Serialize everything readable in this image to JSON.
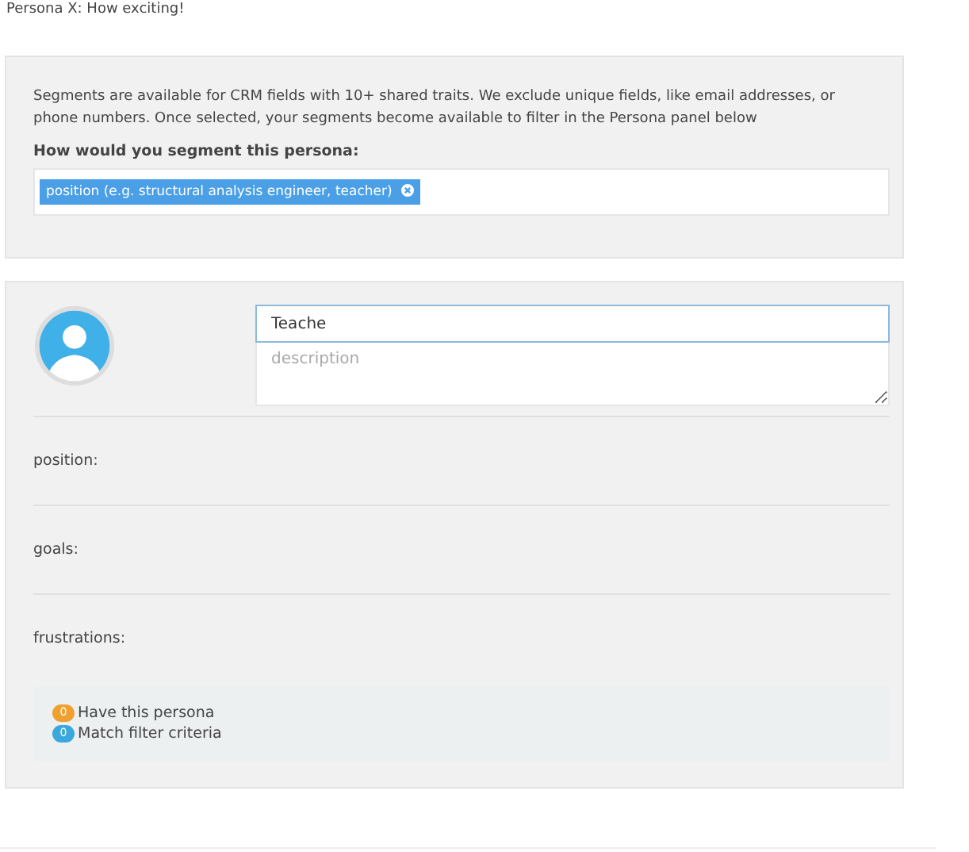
{
  "heading": "Persona X: How exciting!",
  "segments": {
    "info": "Segments are available for CRM fields with 10+ shared traits. We exclude unique fields, like email addresses, or phone numbers. Once selected, your segments become available to filter in the Persona panel below",
    "question": "How would you segment this persona:",
    "tags": [
      {
        "label": "position (e.g. structural analysis engineer, teacher)"
      }
    ]
  },
  "persona": {
    "name": "Teache",
    "description_placeholder": "description",
    "attributes": [
      {
        "label": "position:"
      },
      {
        "label": "goals:"
      },
      {
        "label": "frustrations:"
      }
    ],
    "counts": [
      {
        "count": "0",
        "label": "Have this persona",
        "color": "#f0a030"
      },
      {
        "count": "0",
        "label": "Match filter criteria",
        "color": "#3aa8dc"
      }
    ]
  }
}
